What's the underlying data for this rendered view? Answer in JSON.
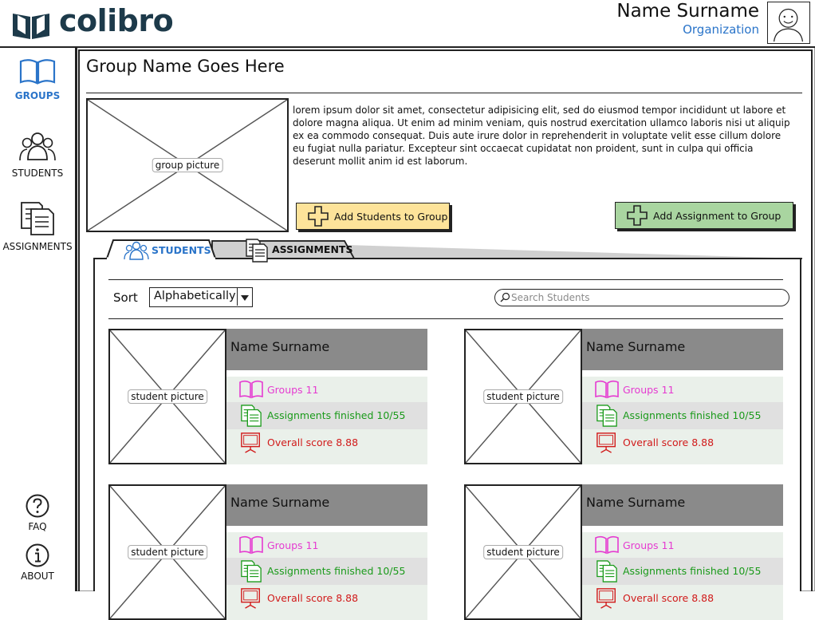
{
  "app": {
    "brand": "colibro"
  },
  "user": {
    "name": "Name Surname",
    "organization": "Organization"
  },
  "sidebar": {
    "items": [
      {
        "label": "GROUPS",
        "active": true
      },
      {
        "label": "STUDENTS",
        "active": false
      },
      {
        "label": "ASSIGNMENTS",
        "active": false
      }
    ],
    "bottom": [
      {
        "label": "FAQ"
      },
      {
        "label": "ABOUT"
      }
    ]
  },
  "group": {
    "title": "Group Name Goes Here",
    "picture_label": "group picture",
    "description": "lorem ipsum dolor sit amet, consectetur adipisicing elit, sed do eiusmod tempor incididunt ut labore et dolore magna aliqua. Ut enim ad minim veniam, quis nostrud exercitation ullamco laboris nisi ut aliquip ex ea commodo consequat. Duis aute irure dolor in reprehenderit in voluptate velit esse cillum dolore eu fugiat nulla pariatur. Excepteur sint occaecat cupidatat non proident, sunt in culpa qui officia deserunt mollit anim id est laborum."
  },
  "actions": {
    "add_students": "Add Students to Group",
    "add_assignment": "Add Assignment to Group"
  },
  "tabs": [
    {
      "label": "STUDENTS",
      "active": true
    },
    {
      "label": "ASSIGNMENTS",
      "active": false
    }
  ],
  "toolbar": {
    "sort_label": "Sort",
    "sort_value": "Alphabetically",
    "search_placeholder": "Search Students"
  },
  "students": [
    {
      "name": "Name Surname",
      "picture_label": "student picture",
      "groups": "Groups 11",
      "assignments": "Assignments finished 10/55",
      "score": "Overall score 8.88"
    },
    {
      "name": "Name Surname",
      "picture_label": "student picture",
      "groups": "Groups 11",
      "assignments": "Assignments finished 10/55",
      "score": "Overall score 8.88"
    },
    {
      "name": "Name Surname",
      "picture_label": "student picture",
      "groups": "Groups 11",
      "assignments": "Assignments finished 10/55",
      "score": "Overall score 8.88"
    },
    {
      "name": "Name Surname",
      "picture_label": "student picture",
      "groups": "Groups 11",
      "assignments": "Assignments finished 10/55",
      "score": "Overall score 8.88"
    }
  ],
  "colors": {
    "brand": "#1d3a4a",
    "accent_blue": "#2a74c9",
    "groups_pink": "#e53bd1",
    "assignments_green": "#1a9a1a",
    "score_red": "#d11a1a",
    "add_students_bg": "#fde39a",
    "add_assignment_bg": "#a9d5a0"
  },
  "icons": {
    "logo": "open-book-icon",
    "groups": "book-icon",
    "students": "people-icon",
    "assignments": "documents-icon",
    "faq": "question-icon",
    "about": "info-icon",
    "add": "plus-icon",
    "search": "search-icon",
    "score": "monitor-icon"
  }
}
